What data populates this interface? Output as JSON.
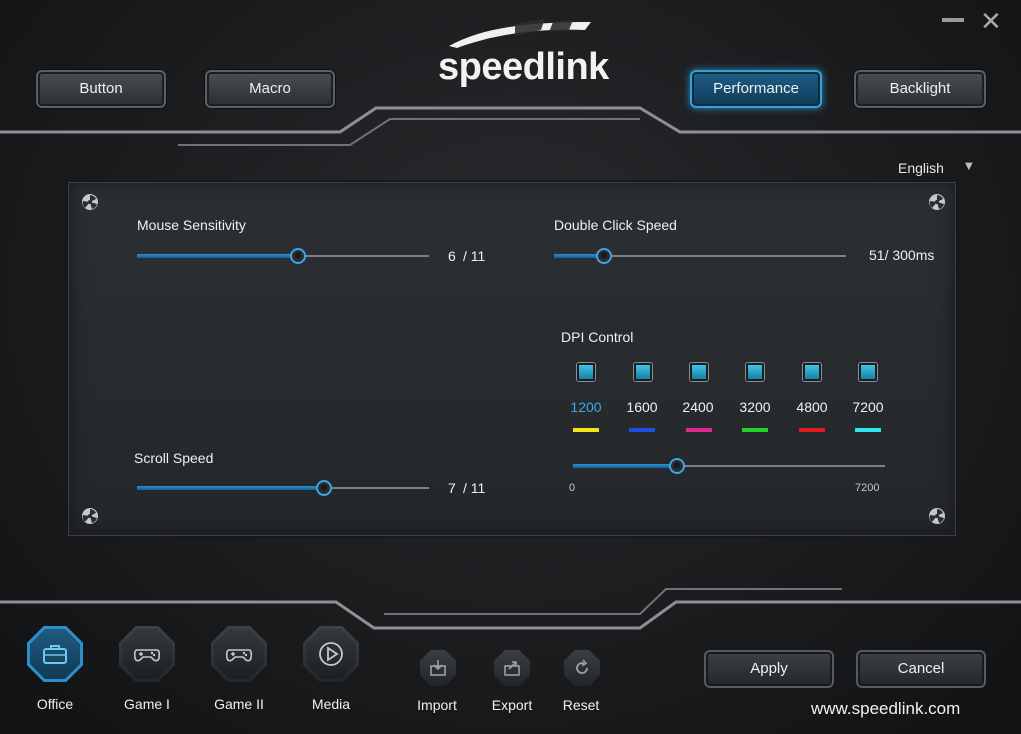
{
  "window": {
    "minimize_icon": "minimize-icon",
    "close_icon": "close-icon"
  },
  "brand": {
    "logo_text": "speedlink",
    "website": "www.speedlink.com"
  },
  "tabs": [
    {
      "label": "Button",
      "active": false
    },
    {
      "label": "Macro",
      "active": false
    },
    {
      "label": "Performance",
      "active": true
    },
    {
      "label": "Backlight",
      "active": false
    }
  ],
  "language": {
    "selected": "English"
  },
  "performance": {
    "mouse_sensitivity": {
      "label": "Mouse Sensitivity",
      "value": 6,
      "max": 11,
      "value_text": "6",
      "max_text": "/ 11"
    },
    "double_click_speed": {
      "label": "Double Click Speed",
      "value_text": "51/ 300ms",
      "value": 51,
      "max": 300
    },
    "scroll_speed": {
      "label": "Scroll Speed",
      "value": 7,
      "max": 11,
      "value_text": "7",
      "max_text": "/ 11"
    },
    "dpi_control": {
      "label": "DPI Control",
      "levels": [
        {
          "value": "1200",
          "color": "#f5e21a",
          "checked": true,
          "active": true
        },
        {
          "value": "1600",
          "color": "#1e4fe0",
          "checked": true,
          "active": false
        },
        {
          "value": "2400",
          "color": "#e0288e",
          "checked": true,
          "active": false
        },
        {
          "value": "3200",
          "color": "#22d12a",
          "checked": true,
          "active": false
        },
        {
          "value": "4800",
          "color": "#e01c1c",
          "checked": true,
          "active": false
        },
        {
          "value": "7200",
          "color": "#2ee4f0",
          "checked": true,
          "active": false
        }
      ],
      "slider_min": "0",
      "slider_max": "7200",
      "slider_value": 2400
    }
  },
  "modes": [
    {
      "label": "Office",
      "icon": "briefcase-icon",
      "active": true
    },
    {
      "label": "Game I",
      "icon": "gamepad-icon",
      "active": false
    },
    {
      "label": "Game II",
      "icon": "gamepad-icon",
      "active": false
    },
    {
      "label": "Media",
      "icon": "play-icon",
      "active": false
    }
  ],
  "tools": [
    {
      "label": "Import",
      "icon": "import-icon"
    },
    {
      "label": "Export",
      "icon": "export-icon"
    },
    {
      "label": "Reset",
      "icon": "reset-icon"
    }
  ],
  "actions": {
    "apply": "Apply",
    "cancel": "Cancel"
  }
}
